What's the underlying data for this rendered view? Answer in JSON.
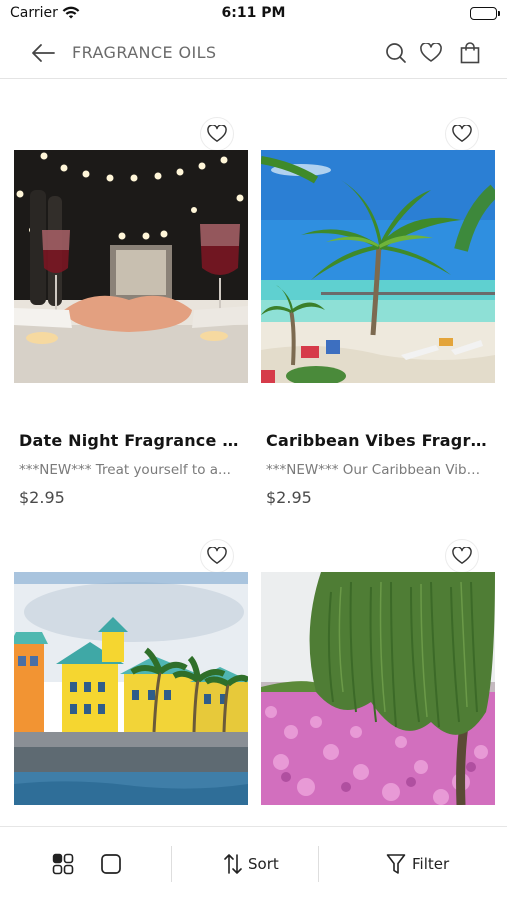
{
  "status_bar": {
    "carrier": "Carrier",
    "time": "6:11 PM"
  },
  "header": {
    "title": "FRAGRANCE OILS"
  },
  "products": [
    {
      "name": "Date Night Fragrance Oil",
      "description": "***NEW*** Treat yourself to a...",
      "price": "$2.95"
    },
    {
      "name": "Caribbean Vibes Fragrance Oil",
      "description": "***NEW*** Our Caribbean Vibes...",
      "price": "$2.95"
    },
    {
      "name": "",
      "description": "",
      "price": ""
    },
    {
      "name": "",
      "description": "",
      "price": ""
    }
  ],
  "bottom_bar": {
    "sort_label": "Sort",
    "filter_label": "Filter"
  },
  "colors": {
    "text": "#111111",
    "muted": "#7a7a7a",
    "title": "#6b6b6b",
    "divider": "#e4e4e4"
  }
}
